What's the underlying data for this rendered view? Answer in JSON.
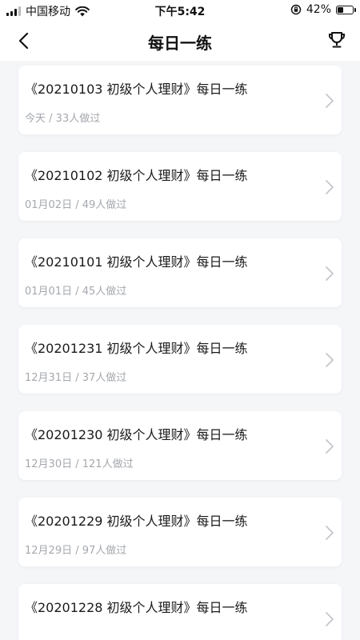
{
  "status_bar": {
    "carrier": "中国移动",
    "time": "下午5:42",
    "battery_percent": "42%",
    "battery_level": 0.42,
    "icons": [
      "signal-icon",
      "wifi-icon",
      "orientation-lock-icon",
      "battery-icon"
    ]
  },
  "nav": {
    "title": "每日一练",
    "back_icon": "chevron-left-icon",
    "trophy_icon": "trophy-icon"
  },
  "exercises": [
    {
      "title": "《20210103 初级个人理财》每日一练",
      "date": "今天",
      "count": "33人做过"
    },
    {
      "title": "《20210102 初级个人理财》每日一练",
      "date": "01月02日",
      "count": "49人做过"
    },
    {
      "title": "《20210101 初级个人理财》每日一练",
      "date": "01月01日",
      "count": "45人做过"
    },
    {
      "title": "《20201231 初级个人理财》每日一练",
      "date": "12月31日",
      "count": "37人做过"
    },
    {
      "title": "《20201230 初级个人理财》每日一练",
      "date": "12月30日",
      "count": "121人做过"
    },
    {
      "title": "《20201229 初级个人理财》每日一练",
      "date": "12月29日",
      "count": "97人做过"
    },
    {
      "title": "《20201228 初级个人理财》每日一练",
      "date": "",
      "count": ""
    }
  ],
  "meta_separator": " / ",
  "colors": {
    "background": "#f5f6f8",
    "card": "#ffffff",
    "title_text": "#1a1a1a",
    "meta_text": "#a5a8ad",
    "chevron": "#c4c6ca"
  }
}
